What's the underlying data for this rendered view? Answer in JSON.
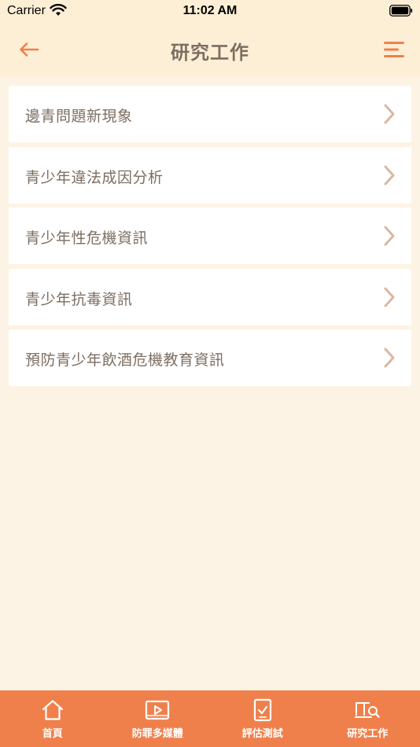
{
  "status": {
    "carrier": "Carrier",
    "time": "11:02 AM"
  },
  "nav": {
    "title": "研究工作"
  },
  "items": [
    {
      "label": "邊青問題新現象"
    },
    {
      "label": "青少年違法成因分析"
    },
    {
      "label": "青少年性危機資訊"
    },
    {
      "label": "青少年抗毒資訊"
    },
    {
      "label": "預防青少年飲酒危機教育資訊"
    }
  ],
  "tabs": [
    {
      "label": "首頁"
    },
    {
      "label": "防罪多媒體"
    },
    {
      "label": "評估測試"
    },
    {
      "label": "研究工作"
    }
  ],
  "colors": {
    "accent": "#f0804b",
    "header_bg": "#fdefd6",
    "page_bg": "#fdf3e4",
    "text": "#7d6e62",
    "chevron": "#d9b8a0"
  }
}
